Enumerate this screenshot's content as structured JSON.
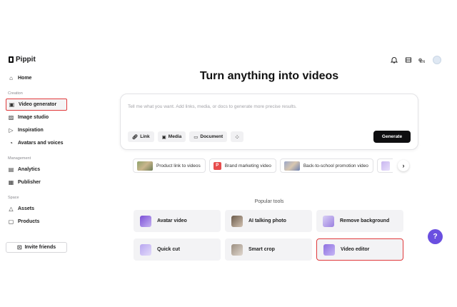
{
  "app": {
    "name": "Pippit"
  },
  "topbar": {
    "icons": [
      "bell-icon",
      "inbox-icon",
      "globe-icon",
      "avatar"
    ],
    "language_badge": "EN"
  },
  "sidebar": {
    "home": "Home",
    "creation_label": "Creation",
    "video_generator": "Video generator",
    "image_studio": "Image studio",
    "inspiration": "Inspiration",
    "avatars_and_voices": "Avatars and voices",
    "management_label": "Management",
    "analytics": "Analytics",
    "publisher": "Publisher",
    "space_label": "Space",
    "assets": "Assets",
    "products": "Products",
    "invite_friends": "Invite friends"
  },
  "main": {
    "title": "Turn anything into videos",
    "prompt_placeholder": "Tell me what you want. Add links, media, or docs to generate more precise results.",
    "chips": {
      "link": "Link",
      "media": "Media",
      "document": "Document"
    },
    "generate_label": "Generate",
    "suggestions": [
      "Product link to videos",
      "Brand marketing video",
      "Back-to-school promotion video"
    ],
    "brand_badge": "P",
    "popular_tools_label": "Popular tools",
    "tools": [
      "Avatar video",
      "AI talking photo",
      "Remove background",
      "Quick cut",
      "Smart crop",
      "Video editor"
    ]
  },
  "help": {
    "label": "?"
  },
  "colors": {
    "accent": "#6a4fe0",
    "highlight_border": "#e0393b",
    "generate_bg": "#0e0e10"
  }
}
